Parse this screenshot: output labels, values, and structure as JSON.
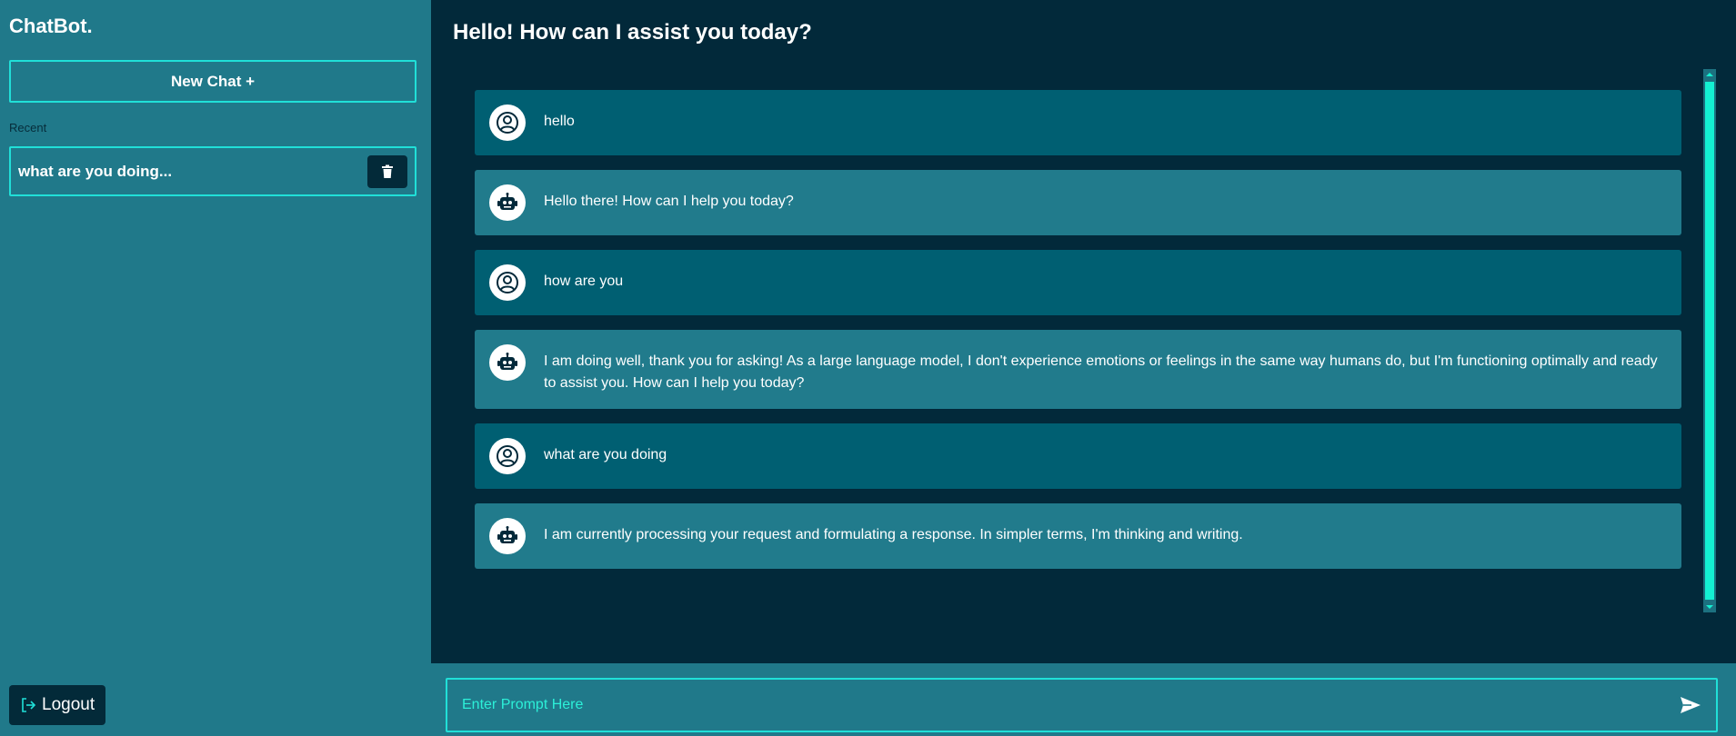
{
  "sidebar": {
    "brand": "ChatBot.",
    "new_chat_label": "New Chat +",
    "recent_label": "Recent",
    "recent_chats": [
      {
        "title": "what are you doing..."
      }
    ],
    "logout_label": "Logout"
  },
  "main": {
    "title": "Hello! How can I assist you today?",
    "messages": [
      {
        "role": "user",
        "icon": "user-circle-icon",
        "text": "hello"
      },
      {
        "role": "bot",
        "icon": "robot-icon",
        "text": "Hello there! How can I help you today?"
      },
      {
        "role": "user",
        "icon": "user-circle-icon",
        "text": "how are you"
      },
      {
        "role": "bot",
        "icon": "robot-icon",
        "text": "I am doing well, thank you for asking!  As a large language model, I don't experience emotions or feelings in the same way humans do, but I'm functioning optimally and ready to assist you. How can I help you today?"
      },
      {
        "role": "user",
        "icon": "user-circle-icon",
        "text": "what are you doing"
      },
      {
        "role": "bot",
        "icon": "robot-icon",
        "text": "I am currently processing your request and formulating a response.  In simpler terms, I'm thinking and writing."
      }
    ],
    "prompt": {
      "placeholder": "Enter Prompt Here",
      "value": ""
    }
  },
  "colors": {
    "sidebar_bg": "#20798a",
    "main_bg": "#02293a",
    "accent": "#20e0d8",
    "user_bubble": "#005f72",
    "bot_bubble": "#217b8c",
    "dark_button": "#032a39"
  }
}
